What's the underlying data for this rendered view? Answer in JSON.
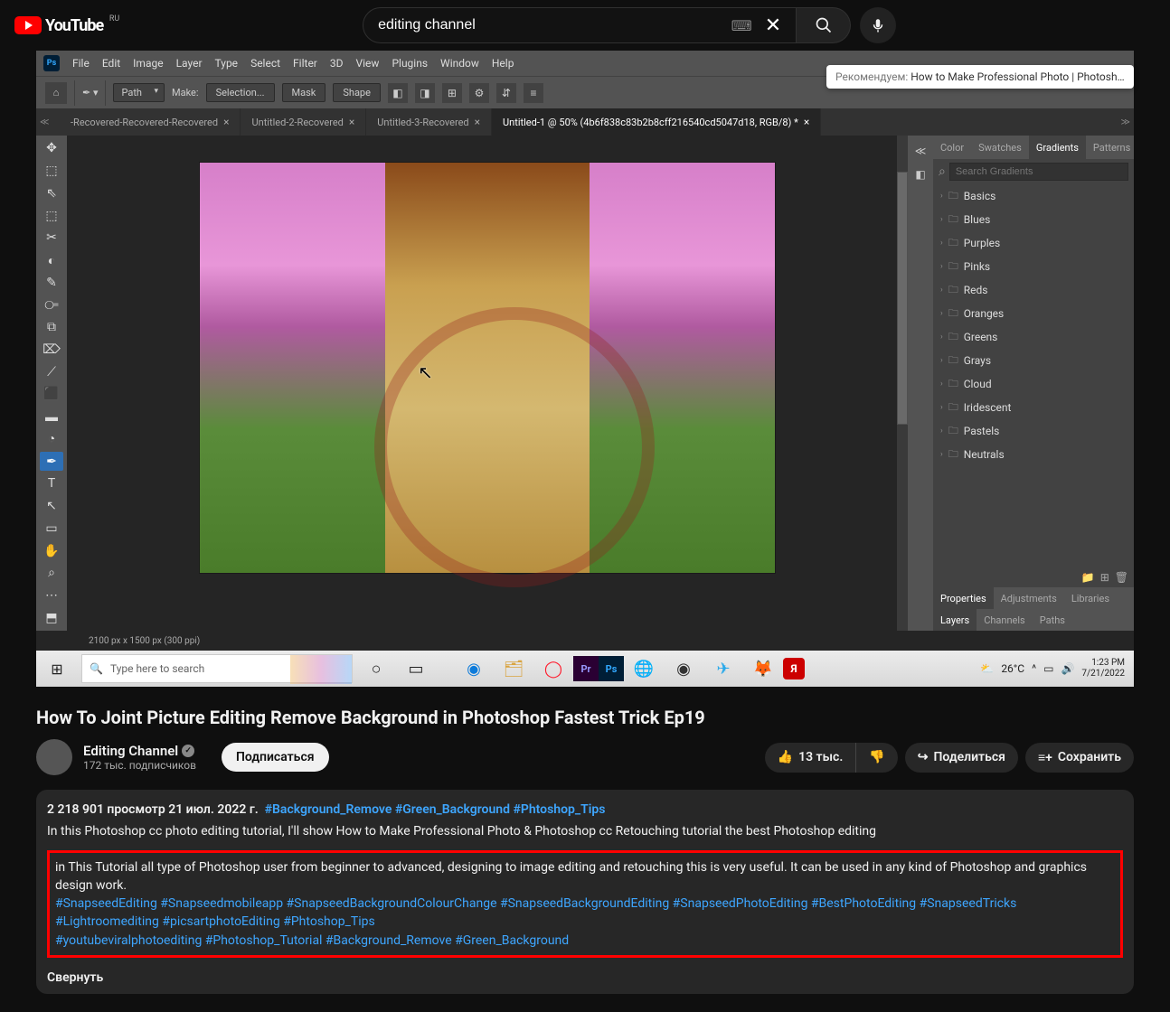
{
  "header": {
    "logo": "YouTube",
    "country": "RU",
    "search_value": "editing channel"
  },
  "recommend": {
    "prefix": "Рекомендуем:",
    "title": "How to Make Professional Photo | Photoshop cc Re..."
  },
  "ps": {
    "menu": [
      "File",
      "Edit",
      "Image",
      "Layer",
      "Type",
      "Select",
      "Filter",
      "3D",
      "View",
      "Plugins",
      "Window",
      "Help"
    ],
    "opt_tool": "Path",
    "opt_make": "Make:",
    "opt_selection": "Selection...",
    "opt_mask": "Mask",
    "opt_shape": "Shape",
    "tabs": [
      {
        "label": "-Recovered-Recovered-Recovered",
        "active": false
      },
      {
        "label": "Untitled-2-Recovered",
        "active": false
      },
      {
        "label": "Untitled-3-Recovered",
        "active": false
      },
      {
        "label": "Untitled-1 @ 50% (4b6f838c83b2b8cff216540cd5047d18, RGB/8) *",
        "active": true
      }
    ],
    "tools": [
      "✥",
      "⬚",
      "⇖",
      "⬚",
      "✂",
      "◐",
      "✎",
      "⧃",
      "⧉",
      "⌦",
      "⟋",
      "⬛",
      "▬",
      "◔",
      "✒",
      "T",
      "↖",
      "▭",
      "✋",
      "⌕",
      "⋯",
      "⬒"
    ],
    "active_tool": 14,
    "panel_tabs_row1": [
      "Color",
      "Swatches",
      "Gradients",
      "Patterns"
    ],
    "panel_grad_search": "Search Gradients",
    "grad_folders": [
      "Basics",
      "Blues",
      "Purples",
      "Pinks",
      "Reds",
      "Oranges",
      "Greens",
      "Grays",
      "Cloud",
      "Iridescent",
      "Pastels",
      "Neutrals"
    ],
    "panel_tabs_row2": [
      "Properties",
      "Adjustments",
      "Libraries"
    ],
    "panel_tabs_row3": [
      "Layers",
      "Channels",
      "Paths"
    ],
    "status": "2100 px x 1500 px (300 ppi)"
  },
  "win": {
    "search_placeholder": "Type here to search",
    "weather": "26°C",
    "time": "1:23 PM",
    "date": "7/21/2022"
  },
  "video": {
    "title": "How To Joint Picture Editing Remove Background in Photoshop Fastest Trick Ep19",
    "channel": "Editing Channel",
    "subs": "172 тыс. подписчиков",
    "subscribe": "Подписаться",
    "likes": "13 тыс.",
    "share": "Поделиться",
    "save": "Сохранить",
    "views_date": "2 218 901 просмотр  21 июл. 2022 г.",
    "head_tags": "#Background_Remove #Green_Background #Phtoshop_Tips",
    "line1": "In this Photoshop cc photo editing tutorial, I'll show How to Make Professional Photo & Photoshop cc Retouching tutorial the best Photoshop editing",
    "box_line1": "in This Tutorial all type of Photoshop user from beginner to advanced, designing to image editing and retouching this is very useful. It can be used in any kind of Photoshop and graphics design work.",
    "box_tags1": "#SnapseedEditing #Snapseedmobileapp  #SnapseedBackgroundColourChange #SnapseedBackgroundEditing #SnapseedPhotoEditing #BestPhotoEditing #SnapseedTricks #Lightroomediting #picsartphotoEditing #Phtoshop_Tips",
    "box_tags2": "#youtubeviralphotoediting #Photoshop_Tutorial  #Background_Remove #Green_Background",
    "collapse": "Свернуть"
  }
}
